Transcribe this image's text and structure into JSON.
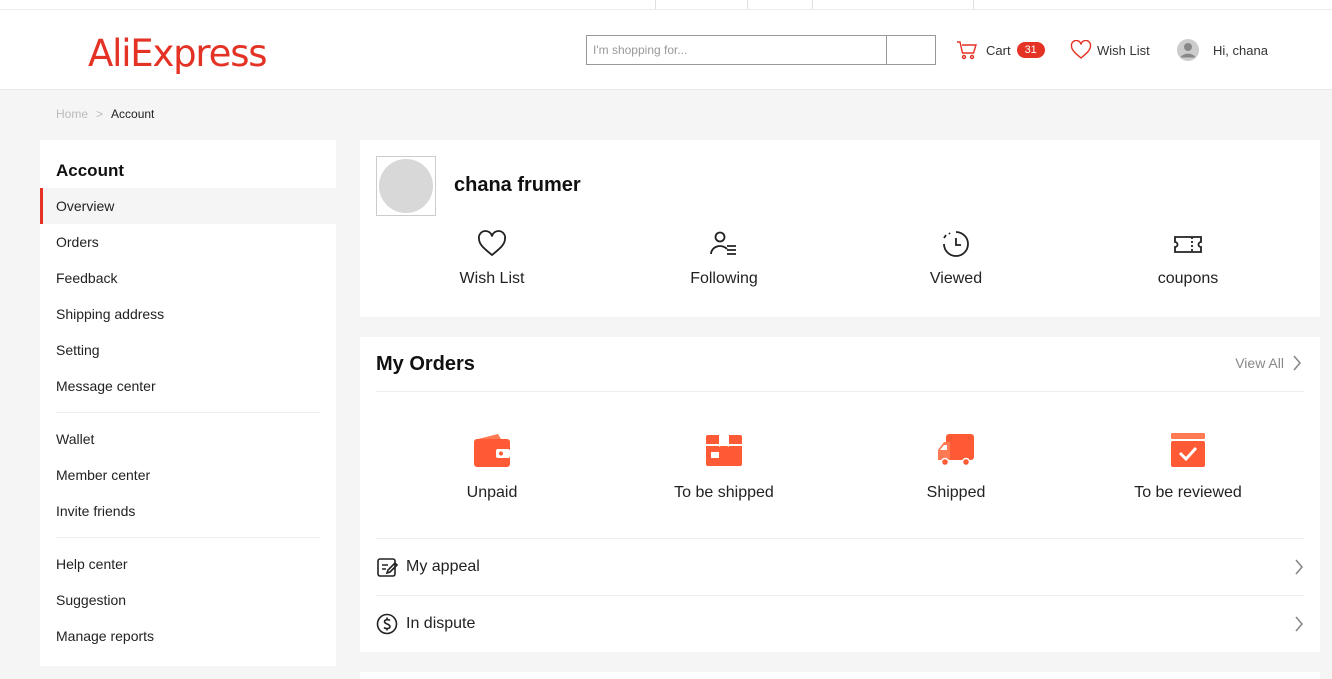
{
  "header": {
    "logo": "AliExpress",
    "search_placeholder": "I'm shopping for...",
    "cart_label": "Cart",
    "cart_count": "31",
    "wishlist_label": "Wish List",
    "greeting": "Hi, chana"
  },
  "breadcrumb": {
    "home": "Home",
    "separator": ">",
    "current": "Account"
  },
  "sidebar": {
    "title": "Account",
    "groups": [
      [
        "Overview",
        "Orders",
        "Feedback",
        "Shipping address",
        "Setting",
        "Message center"
      ],
      [
        "Wallet",
        "Member center",
        "Invite friends"
      ],
      [
        "Help center",
        "Suggestion",
        "Manage reports"
      ]
    ]
  },
  "profile": {
    "name": "chana frumer",
    "quicklinks": [
      {
        "label": "Wish List",
        "icon": "heart-icon"
      },
      {
        "label": "Following",
        "icon": "following-icon"
      },
      {
        "label": "Viewed",
        "icon": "clock-icon"
      },
      {
        "label": "coupons",
        "icon": "coupon-icon"
      }
    ]
  },
  "orders": {
    "title": "My Orders",
    "view_all": "View All",
    "statuses": [
      {
        "label": "Unpaid",
        "icon": "wallet-icon"
      },
      {
        "label": "To be shipped",
        "icon": "package-icon"
      },
      {
        "label": "Shipped",
        "icon": "truck-icon"
      },
      {
        "label": "To be reviewed",
        "icon": "review-box-icon"
      }
    ],
    "rows": [
      {
        "label": "My appeal",
        "icon": "appeal-icon"
      },
      {
        "label": "In dispute",
        "icon": "dispute-icon"
      }
    ]
  },
  "colors": {
    "brand": "#e43225",
    "accent": "#ff5a36"
  }
}
